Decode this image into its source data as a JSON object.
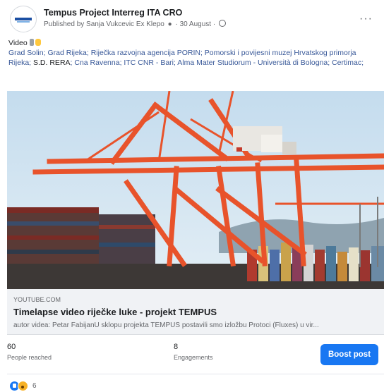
{
  "header": {
    "page_name": "Tempus Project Interreg ITA CRO",
    "published_by": "Published by Sanja Vukcevic Ex Klepo",
    "date": "30 August",
    "more_label": "···"
  },
  "post": {
    "intro": "Video",
    "tags_line": "Grad Solin; Grad Rijeka; Riječka razvojna agencija PORIN;  Pomorski i povijesni muzej Hrvatskog primorja Rijeka; ",
    "tag_plain": "S.D. RERA",
    "tags_line2": "; Cna Ravenna; ITC CNR - Bari; Alma Mater Studiorum - Università di Bologna; Certimac;"
  },
  "link_preview": {
    "domain": "YOUTUBE.COM",
    "title": "Timelapse video riječke luke - projekt TEMPUS",
    "description": "autor videa: Petar FabijanU sklopu projekta TEMPUS postavili smo izložbu Protoci (Fluxes) u vir..."
  },
  "stats": {
    "reached_value": "60",
    "reached_label": "People reached",
    "engagements_value": "8",
    "engagements_label": "Engagements",
    "boost_label": "Boost post"
  },
  "reactions": {
    "count": "6",
    "icons": [
      "like-icon",
      "wow-icon"
    ]
  },
  "colors": {
    "accent": "#1877f2",
    "link": "#385898",
    "crane": "#e8532b"
  }
}
